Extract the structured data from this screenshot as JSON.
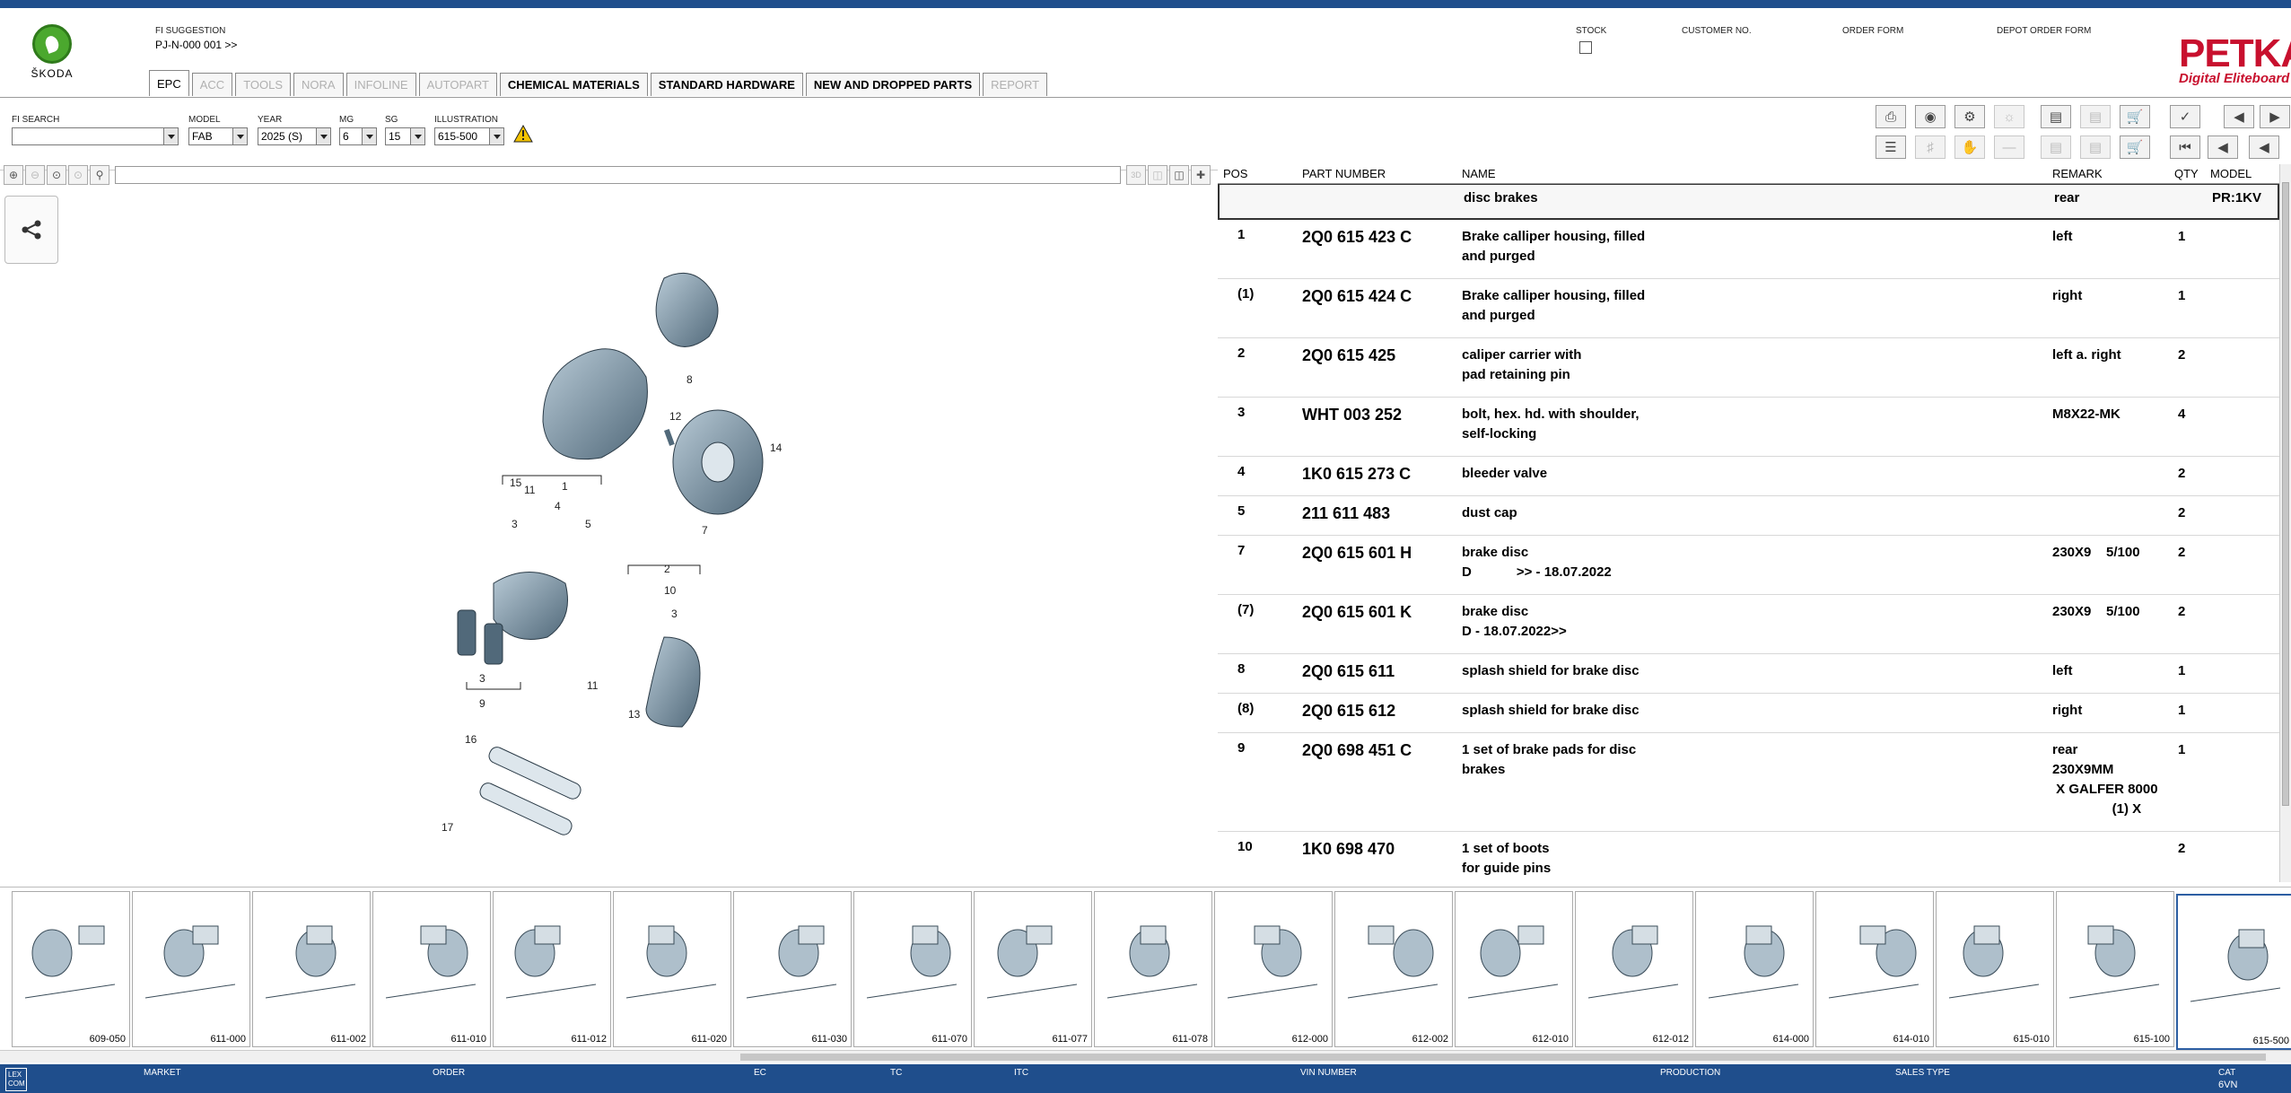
{
  "header": {
    "brand_text": "ŠKODA",
    "fi_suggestion_label": "FI SUGGESTION",
    "fi_suggestion_value": "PJ-N-000 001 >>",
    "stock_label": "STOCK",
    "customer_no_label": "CUSTOMER NO.",
    "order_form_label": "ORDER FORM",
    "depot_order_form_label": "DEPOT ORDER FORM",
    "petka_title": "PETKA",
    "petka_subtitle": "Digital Eliteboard"
  },
  "tabs": [
    {
      "label": "EPC",
      "state": "active"
    },
    {
      "label": "ACC",
      "state": "disabled"
    },
    {
      "label": "TOOLS",
      "state": "disabled"
    },
    {
      "label": "NORA",
      "state": "disabled"
    },
    {
      "label": "INFOLINE",
      "state": "disabled"
    },
    {
      "label": "AUTOPART",
      "state": "disabled"
    },
    {
      "label": "CHEMICAL MATERIALS",
      "state": "enabled"
    },
    {
      "label": "STANDARD HARDWARE",
      "state": "enabled"
    },
    {
      "label": "NEW AND DROPPED PARTS",
      "state": "enabled"
    },
    {
      "label": "REPORT",
      "state": "disabled"
    }
  ],
  "filters": {
    "fi_search_label": "FI SEARCH",
    "fi_search_value": "",
    "model_label": "MODEL",
    "model_value": "FAB",
    "year_label": "YEAR",
    "year_value": "2025 (S)",
    "mg_label": "MG",
    "mg_value": "6",
    "sg_label": "SG",
    "sg_value": "15",
    "illustration_label": "ILLUSTRATION",
    "illustration_value": "615-500"
  },
  "icons": {
    "warning": "warning-triangle-icon",
    "share": "share-icon",
    "thumbnail_view": "3D"
  },
  "parts_table": {
    "columns": {
      "pos": "POS",
      "part_number": "PART NUMBER",
      "name": "NAME",
      "remark": "REMARK",
      "qty": "QTY",
      "model": "MODEL"
    },
    "group": {
      "name": "disc brakes",
      "remark": "rear",
      "model": "PR:1KV"
    },
    "rows": [
      {
        "pos": "1",
        "pn": "2Q0 615 423 C",
        "name": "Brake calliper housing, filled\nand purged",
        "remark": "left",
        "qty": "1",
        "h": 66
      },
      {
        "pos": "(1)",
        "pn": "2Q0 615 424 C",
        "name": "Brake calliper housing, filled\nand purged",
        "remark": "right",
        "qty": "1",
        "h": 66
      },
      {
        "pos": "2",
        "pn": "2Q0 615 425",
        "name": "caliper carrier with\npad retaining pin",
        "remark": "left a. right",
        "qty": "2",
        "h": 66
      },
      {
        "pos": "3",
        "pn": "WHT 003 252",
        "name": "bolt, hex. hd. with shoulder,\nself-locking",
        "remark": "M8X22-MK",
        "qty": "4",
        "h": 66
      },
      {
        "pos": "4",
        "pn": "1K0 615 273 C",
        "name": "bleeder valve",
        "remark": "",
        "qty": "2",
        "h": 44
      },
      {
        "pos": "5",
        "pn": "211 611 483",
        "name": "dust cap",
        "remark": "",
        "qty": "2",
        "h": 44
      },
      {
        "pos": "7",
        "pn": "2Q0 615 601 H",
        "name": "brake disc\nD            >> - 18.07.2022",
        "remark": "230X9    5/100",
        "qty": "2",
        "h": 66
      },
      {
        "pos": "(7)",
        "pn": "2Q0 615 601 K",
        "name": "brake disc\nD - 18.07.2022>>",
        "remark": "230X9    5/100",
        "qty": "2",
        "h": 66
      },
      {
        "pos": "8",
        "pn": "2Q0 615 611",
        "name": "splash shield for brake disc",
        "remark": "left",
        "qty": "1",
        "h": 44
      },
      {
        "pos": "(8)",
        "pn": "2Q0 615 612",
        "name": "splash shield for brake disc",
        "remark": "right",
        "qty": "1",
        "h": 44
      },
      {
        "pos": "9",
        "pn": "2Q0 698 451 C",
        "name": "1 set of brake pads for disc\nbrakes",
        "remark": "rear\n230X9MM\n X GALFER 8000\n                (1) X",
        "qty": "1",
        "h": 110
      },
      {
        "pos": "10",
        "pn": "1K0 698 470",
        "name": "1 set of boots\nfor guide pins",
        "remark": "",
        "qty": "2",
        "h": 66
      }
    ]
  },
  "thumbnails": [
    "609-050",
    "611-000",
    "611-002",
    "611-010",
    "611-012",
    "611-020",
    "611-030",
    "611-070",
    "611-077",
    "611-078",
    "612-000",
    "612-002",
    "612-010",
    "612-012",
    "614-000",
    "614-010",
    "615-010",
    "615-100",
    "615-500"
  ],
  "selected_thumbnail": "615-500",
  "drawing_callouts": [
    "8",
    "12",
    "14",
    "7",
    "15",
    "11",
    "1",
    "4",
    "3",
    "5",
    "2",
    "10",
    "3",
    "3",
    "9",
    "11",
    "13",
    "16",
    "17"
  ],
  "status_bar": {
    "logo": "LEX COM",
    "items": [
      "MARKET",
      "ORDER",
      "EC",
      "TC",
      "ITC",
      "VIN NUMBER",
      "PRODUCTION",
      "SALES TYPE",
      "CAT"
    ],
    "cat_value": "6VN"
  },
  "colors": {
    "accent": "#1f4e8c",
    "brand_green": "#4ba82e",
    "petka_red": "#c8102e",
    "warning": "#f2c200"
  }
}
